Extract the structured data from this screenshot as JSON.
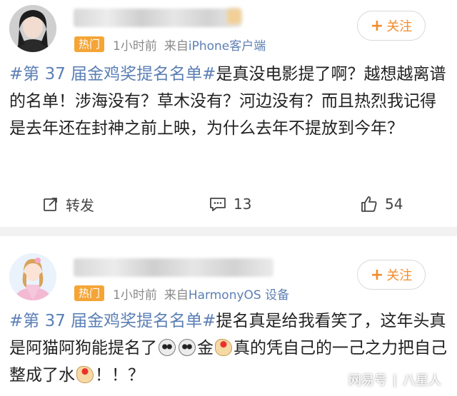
{
  "posts": [
    {
      "hot_badge": "热门",
      "time": "1小时前",
      "source_prefix": "来自",
      "client": "iPhone客户端",
      "follow_label": "关注",
      "topic": "#第 37 届金鸡奖提名名单#",
      "text": "是真没电影提了啊？越想越离谱的名单！涉海没有？草木没有？河边没有？而且热烈我记得是去年还在封神之前上映，为什么去年不提放到今年？",
      "repost_label": "转发",
      "comment_count": "13",
      "like_count": "54"
    },
    {
      "hot_badge": "热门",
      "time": "1小时前",
      "source_prefix": "来自",
      "client": "HarmonyOS 设备",
      "follow_label": "关注",
      "topic": "#第 37 届金鸡奖提名名单#",
      "text_part1": "提名真是给我看笑了，这年头真是阿猫阿狗能提名了",
      "text_part2": "金",
      "text_part3": "真的凭自己的一己之力把自己整成了水",
      "text_part4": "！！？"
    }
  ],
  "watermark": {
    "left": "网易号",
    "right": "八星人"
  },
  "colors": {
    "topic": "#5b7fb5",
    "follow": "#f28c2a",
    "hot_badge": "#f4a536"
  },
  "icons": {
    "repost": "repost-icon",
    "comment": "comment-icon",
    "like": "thumbs-up-icon",
    "emoji1": "panda-emoji",
    "emoji2": "chicken-emoji"
  }
}
